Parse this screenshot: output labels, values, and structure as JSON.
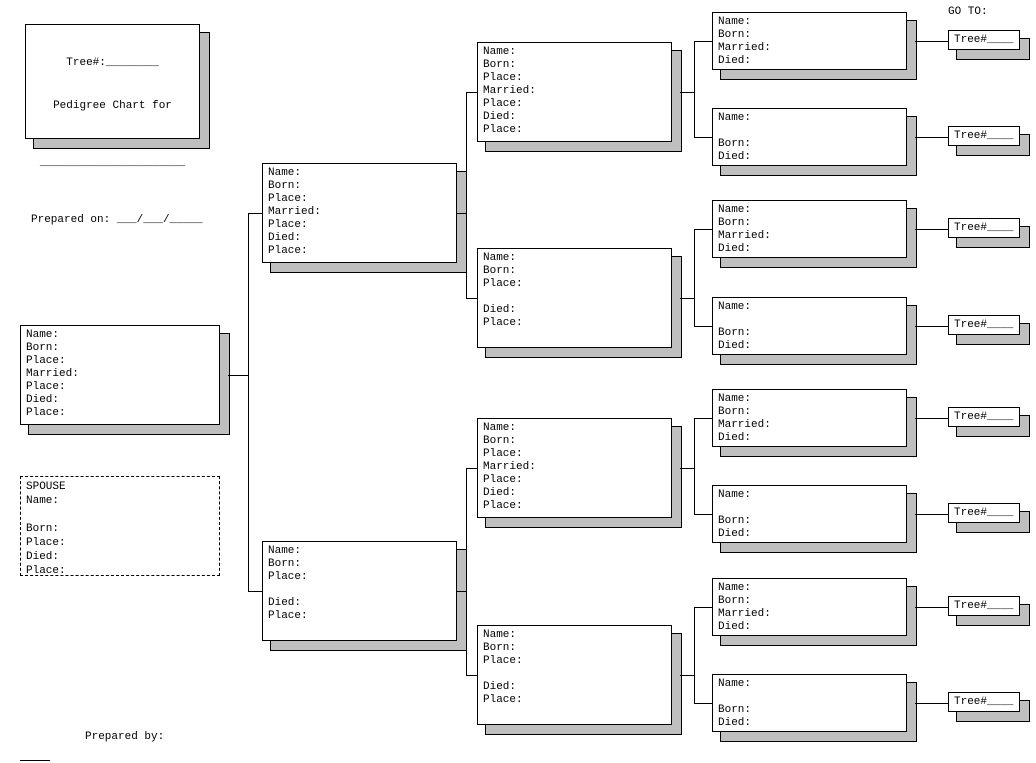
{
  "header": {
    "tree_no": "Tree#:________",
    "title": "Pedigree Chart for",
    "name_line": "______________________",
    "prepared_on": "Prepared on: ___/___/_____"
  },
  "footer": {
    "prepared_by": "Prepared by:"
  },
  "goto_label": "GO TO:",
  "tree_ref": "Tree#____",
  "fields_full": "Name:\nBorn:\nPlace:\nMarried:\nPlace:\nDied:\nPlace:",
  "fields_nomar": "Name:\nBorn:\nPlace:\n\nDied:\nPlace:",
  "fields_gen4_mar": "Name:\nBorn:\nMarried:\nDied:",
  "fields_gen4_nomar": "Name:\n\nBorn:\nDied:",
  "spouse": "SPOUSE\nName:\n\nBorn:\nPlace:\nDied:\nPlace:"
}
